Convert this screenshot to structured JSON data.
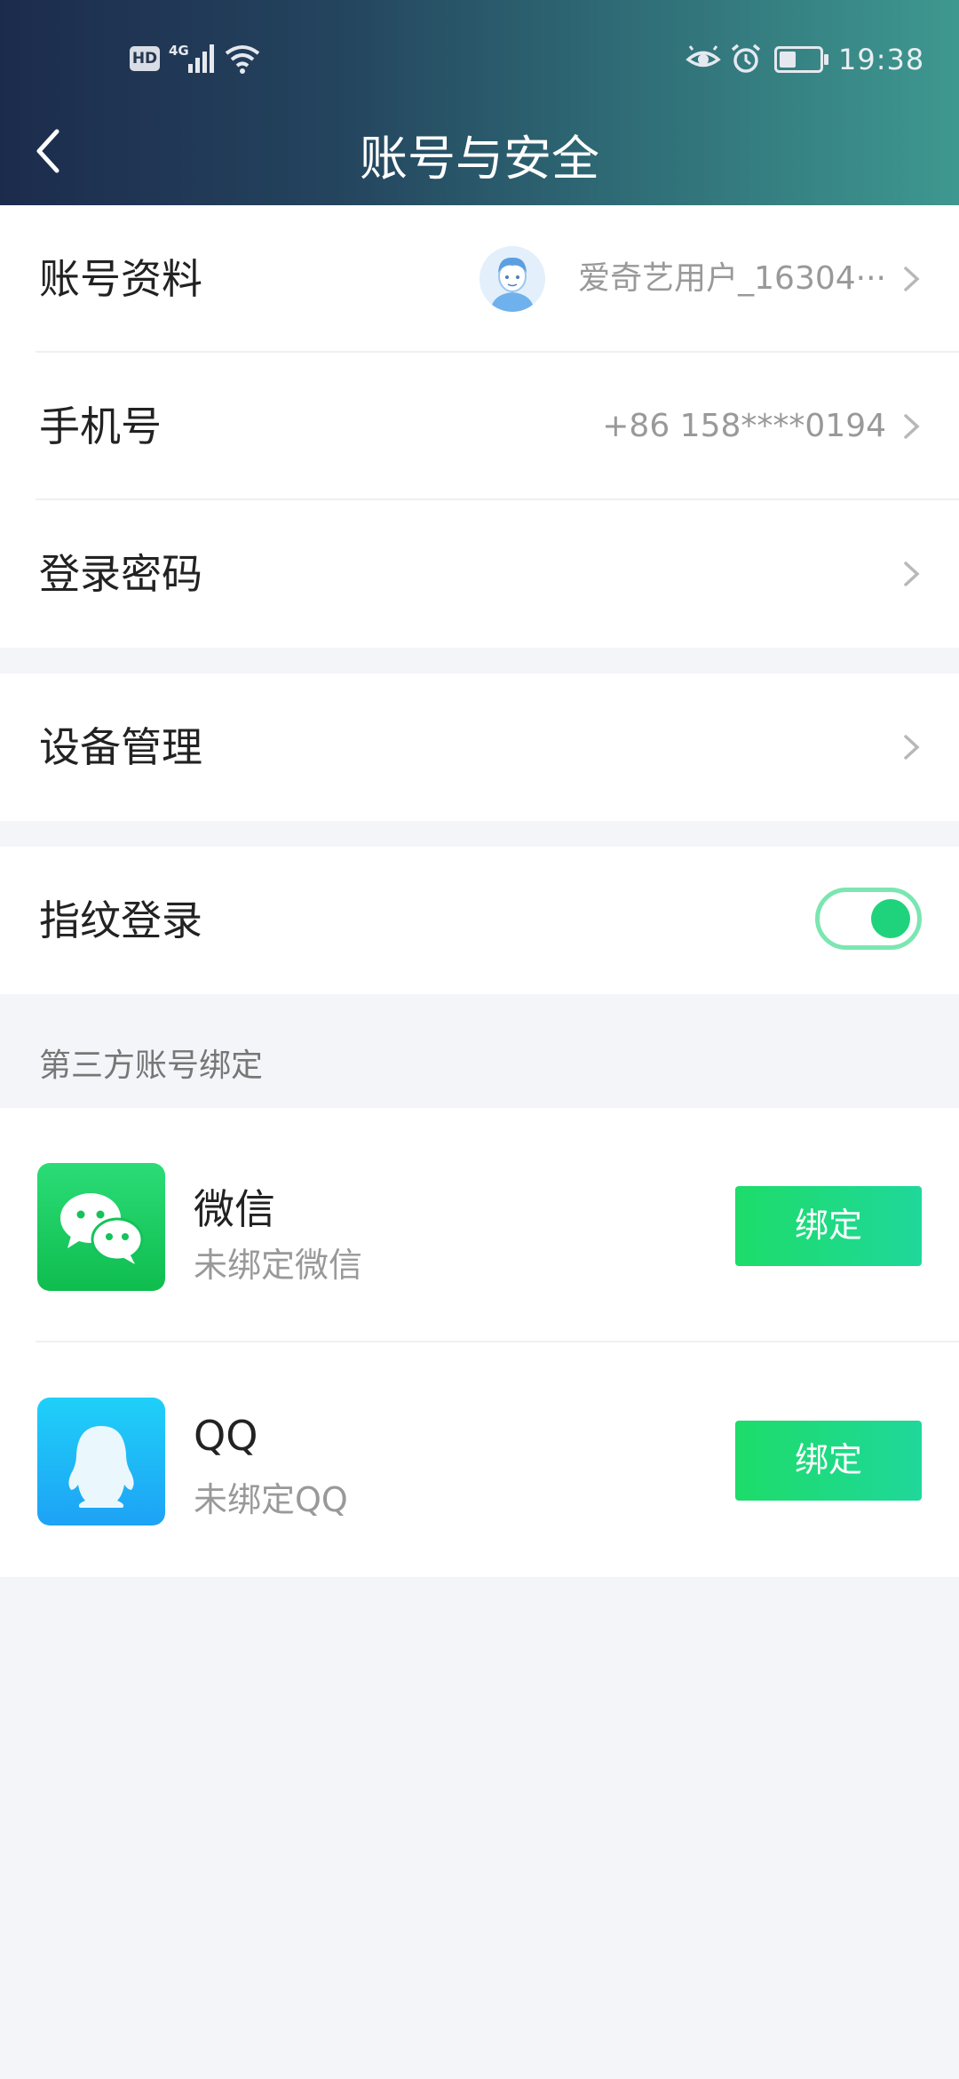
{
  "status_bar": {
    "hd_label": "HD",
    "network_label": "4G",
    "time": "19:38"
  },
  "header": {
    "title": "账号与安全"
  },
  "account": {
    "profile_label": "账号资料",
    "profile_value": "爱奇艺用户_16304···",
    "phone_label": "手机号",
    "phone_value": "+86 158****0194",
    "password_label": "登录密码"
  },
  "devices": {
    "label": "设备管理"
  },
  "fingerprint": {
    "label": "指纹登录",
    "enabled": true
  },
  "third_party": {
    "section_title": "第三方账号绑定",
    "items": [
      {
        "name": "微信",
        "status": "未绑定微信",
        "button": "绑定",
        "icon": "wechat-icon"
      },
      {
        "name": "QQ",
        "status": "未绑定QQ",
        "button": "绑定",
        "icon": "qq-icon"
      }
    ]
  },
  "colors": {
    "accent": "#1fd37c",
    "header_start": "#1c2b4c",
    "header_end": "#3e9890"
  }
}
